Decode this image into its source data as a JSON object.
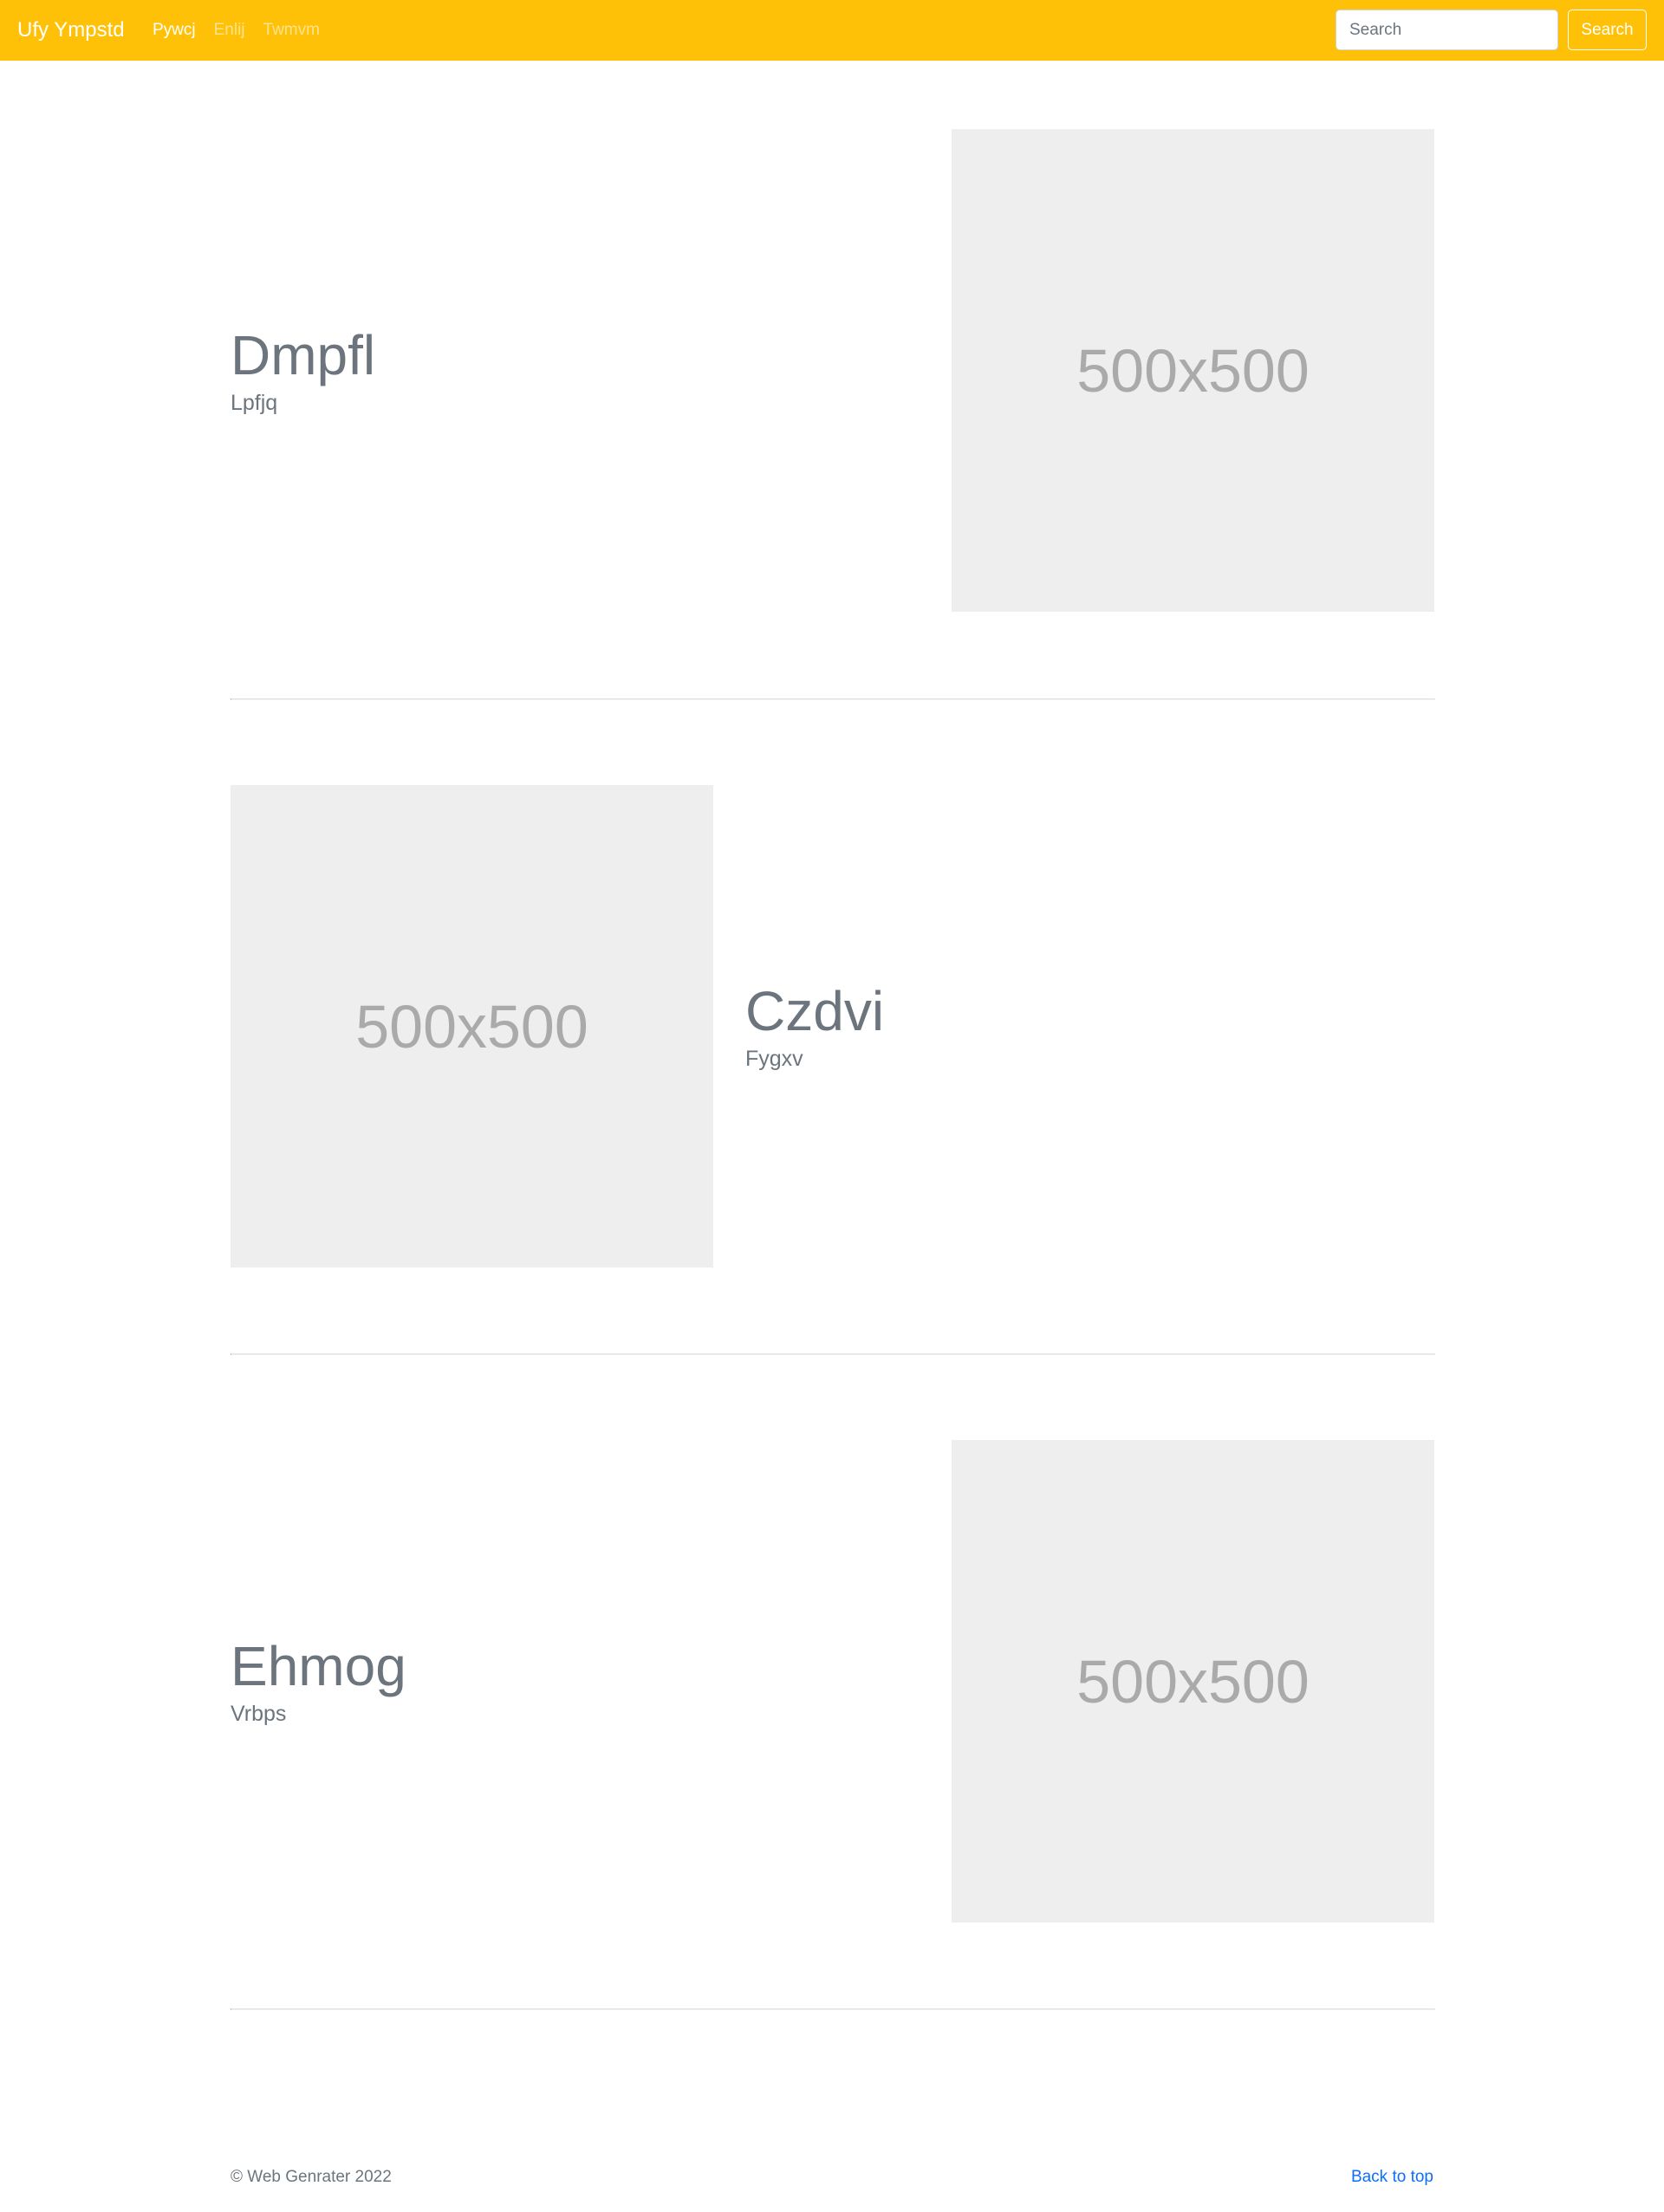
{
  "navbar": {
    "brand": "Ufy Ympstd",
    "links": [
      {
        "label": "Pywcj",
        "active": true
      },
      {
        "label": "Enlij",
        "active": false
      },
      {
        "label": "Twmvm",
        "active": false
      }
    ],
    "search_placeholder": "Search",
    "search_value": "",
    "search_button": "Search",
    "color": "#ffc107"
  },
  "features": [
    {
      "heading": "Dmpfl",
      "lead": "Lpfjq",
      "image_label": "500x500",
      "image_side": "right"
    },
    {
      "heading": "Czdvi",
      "lead": "Fygxv",
      "image_label": "500x500",
      "image_side": "left"
    },
    {
      "heading": "Ehmog",
      "lead": "Vrbps",
      "image_label": "500x500",
      "image_side": "right"
    }
  ],
  "footer": {
    "copyright": "© Web Genrater 2022",
    "back_to_top": "Back to top",
    "link_color": "#0d6efd"
  }
}
